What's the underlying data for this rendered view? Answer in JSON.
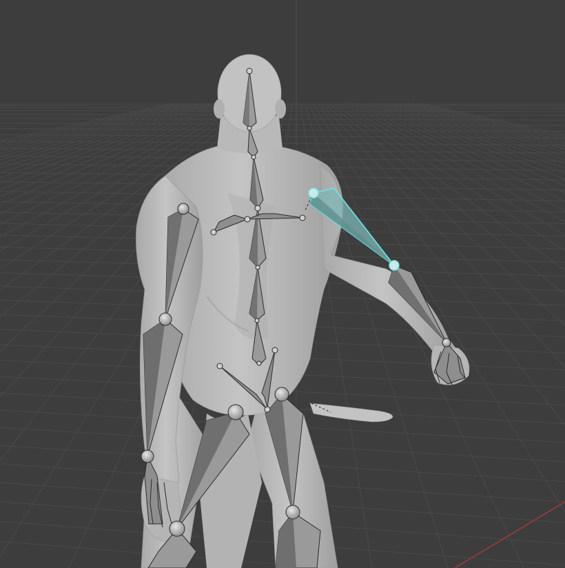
{
  "viewport": {
    "view": "perspective",
    "background_color": "#3d3d3d",
    "grid_color": "#4a4a4a",
    "axis_x_color": "#a33b3b",
    "axis_z_color": "#545454"
  },
  "model": {
    "body_color": "#b8b8b8",
    "body_shadow_color": "#8f8f8f"
  },
  "armature": {
    "bone_color": "#9a9a9a",
    "bone_dark_color": "#6c6c6c",
    "bone_outline_color": "#2a2a2a",
    "selected_bone": "upper-arm-right",
    "selected_outline_color": "#6ee6e6",
    "selected_fill_color": "#7fb5b5"
  }
}
